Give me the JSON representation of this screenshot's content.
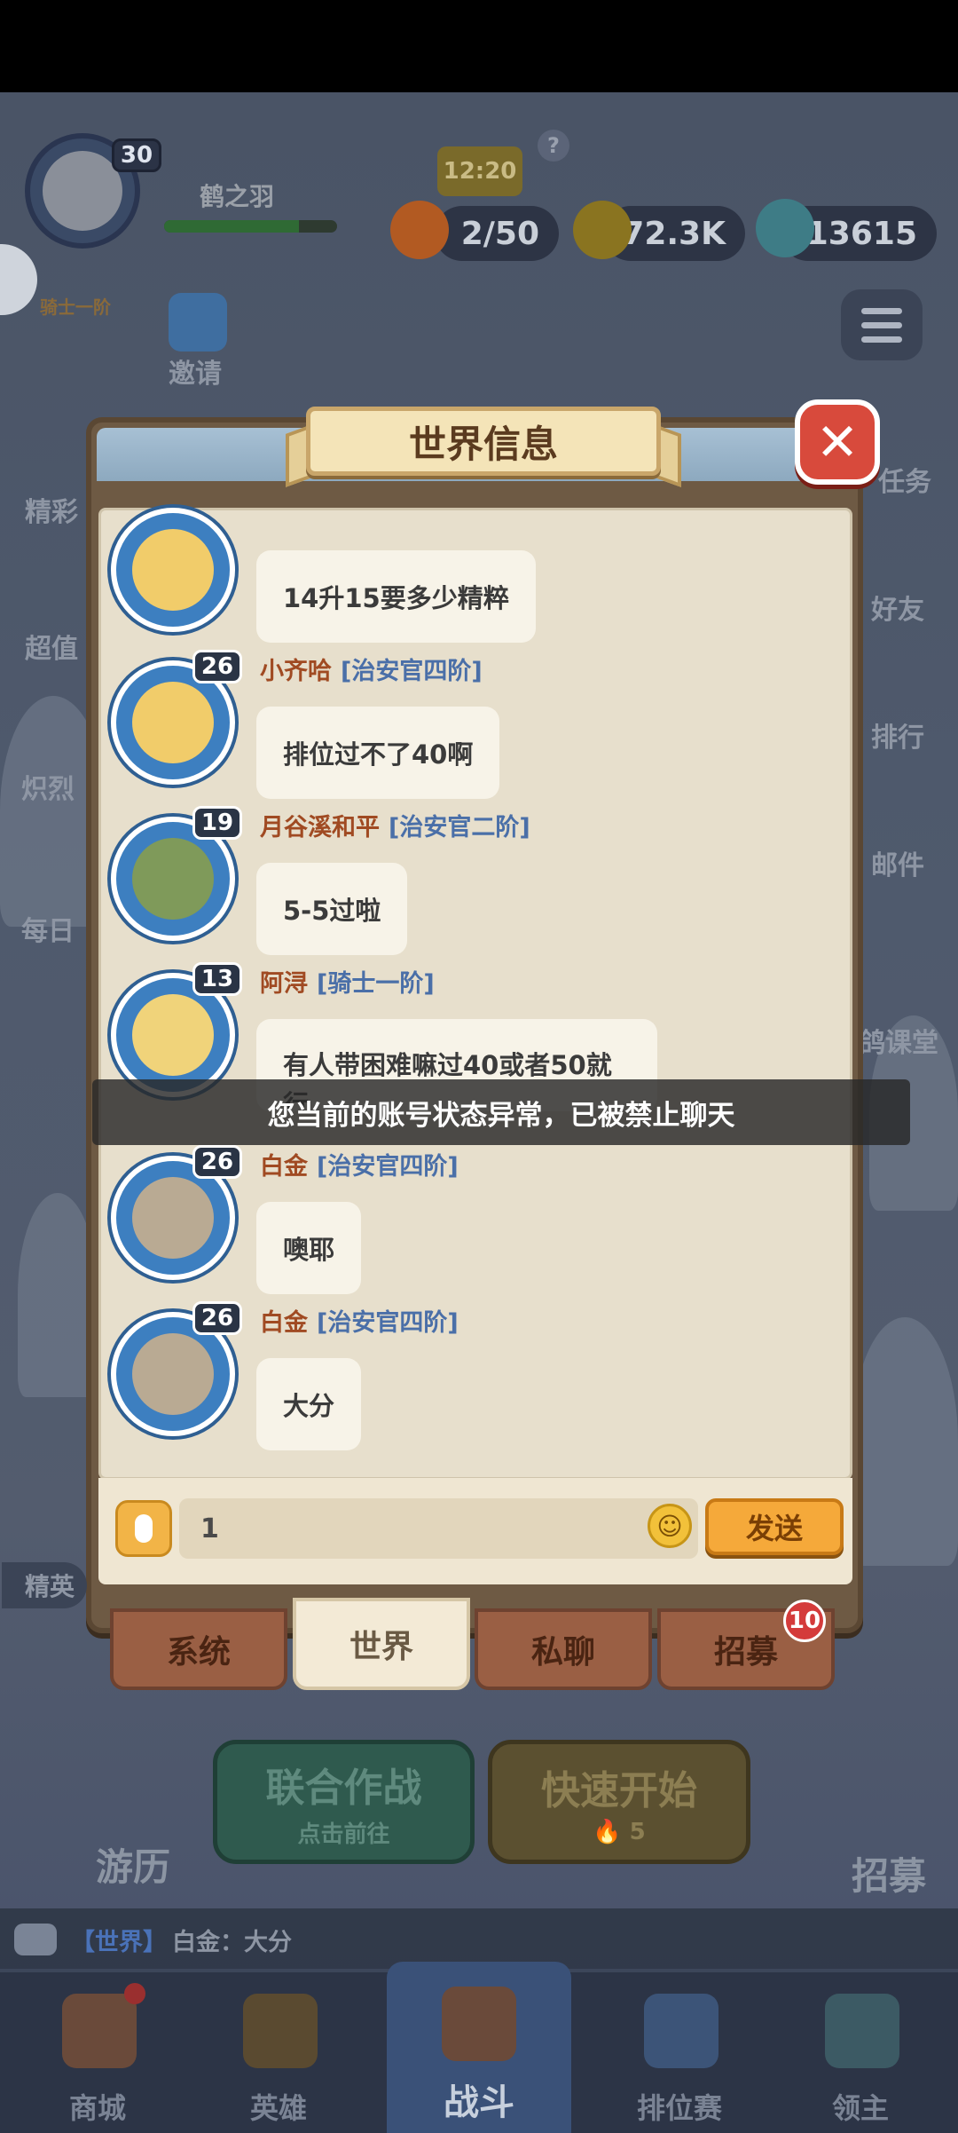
{
  "hud": {
    "player_level": "30",
    "player_name": "鹤之羽",
    "rank_tag": "骑士一阶",
    "exp_progress": 0.78,
    "timer": "12:20",
    "stamina": "2/50",
    "gold": "72.3K",
    "gems": "13615",
    "invite_label": "邀请"
  },
  "side_left": [
    "精彩",
    "超值",
    "炽烈",
    "每日"
  ],
  "side_right": [
    "任务",
    "好友",
    "排行",
    "邮件",
    "鸽课堂"
  ],
  "dialog": {
    "title": "世界信息",
    "close_icon": "close-icon"
  },
  "messages": [
    {
      "level": "",
      "name": "",
      "rank": "",
      "text": "14升15要多少精粹",
      "avatar_color": "#f1cc6a"
    },
    {
      "level": "26",
      "name": "小齐哈",
      "rank": "[治安官四阶]",
      "text": "排位过不了40啊",
      "avatar_color": "#f1cc6a"
    },
    {
      "level": "19",
      "name": "月谷溪和平",
      "rank": "[治安官二阶]",
      "text": "5-5过啦",
      "avatar_color": "#7f9a5a"
    },
    {
      "level": "13",
      "name": "阿浔",
      "rank": "[骑士一阶]",
      "text": "有人带困难嘛过40或者50就行",
      "avatar_color": "#f0d37a"
    },
    {
      "level": "26",
      "name": "白金",
      "rank": "[治安官四阶]",
      "text": "噢耶",
      "avatar_color": "#b9aa93"
    },
    {
      "level": "26",
      "name": "白金",
      "rank": "[治安官四阶]",
      "text": "大分",
      "avatar_color": "#b9aa93"
    }
  ],
  "toast": "您当前的账号状态异常，已被禁止聊天",
  "input": {
    "value": "1",
    "send_label": "发送"
  },
  "tabs": [
    {
      "label": "系统"
    },
    {
      "label": "世界"
    },
    {
      "label": "私聊"
    },
    {
      "label": "招募"
    }
  ],
  "recruit_badge": "10",
  "elite_tag": "精英",
  "actions": {
    "joint_title": "联合作战",
    "joint_sub": "点击前往",
    "quick_title": "快速开始",
    "quick_cost": "5",
    "travel_label": "游历",
    "recruit_label": "招募"
  },
  "ticker": {
    "channel": "【世界】",
    "text": "白金：大分"
  },
  "nav": [
    {
      "label": "商城"
    },
    {
      "label": "英雄"
    },
    {
      "label": "战斗"
    },
    {
      "label": "排位赛"
    },
    {
      "label": "领主"
    }
  ],
  "colors": {
    "accent_send": "#f5a93a",
    "name_color": "#a04a22",
    "rank_color": "#4a6fa8",
    "badge_red": "#d43b3b"
  }
}
